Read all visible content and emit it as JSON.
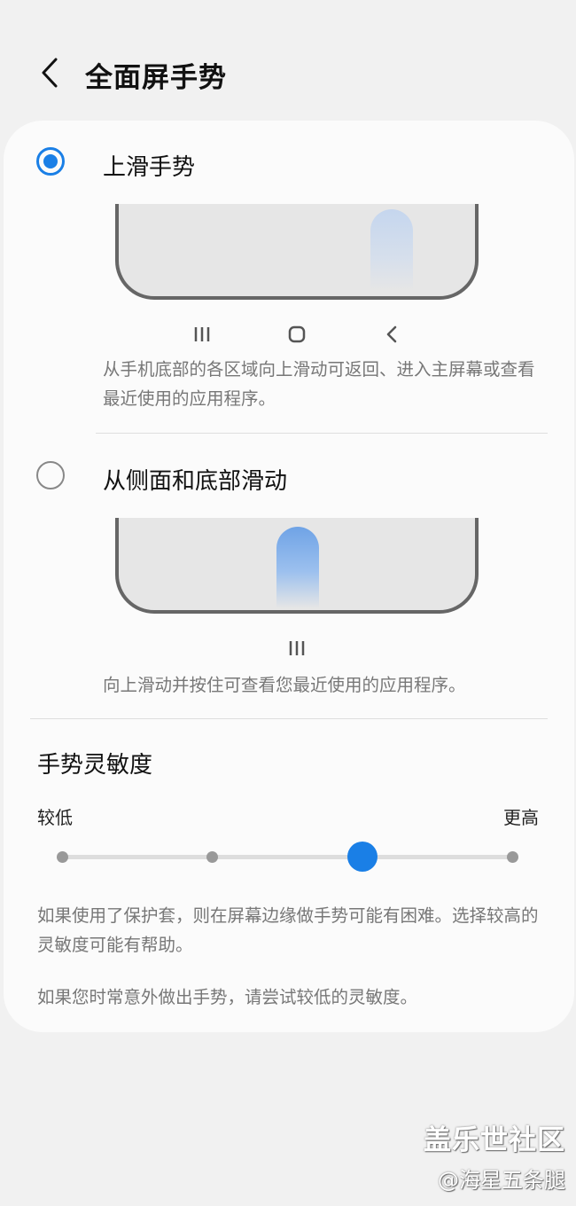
{
  "header": {
    "title": "全面屏手势"
  },
  "options": [
    {
      "label": "上滑手势",
      "selected": true,
      "description": "从手机底部的各区域向上滑动可返回、进入主屏幕或查看最近使用的应用程序。",
      "nav_icons": [
        "recents-icon",
        "home-icon",
        "back-icon"
      ]
    },
    {
      "label": "从侧面和底部滑动",
      "selected": false,
      "description": "向上滑动并按住可查看您最近使用的应用程序。",
      "nav_icons": [
        "recents-icon"
      ]
    }
  ],
  "sensitivity": {
    "title": "手势灵敏度",
    "low_label": "较低",
    "high_label": "更高",
    "steps": 4,
    "value": 3,
    "note1": "如果使用了保护套，则在屏幕边缘做手势可能有困难。选择较高的灵敏度可能有帮助。",
    "note2": "如果您时常意外做出手势，请尝试较低的灵敏度。"
  },
  "colors": {
    "accent": "#1a7fe6",
    "background": "#f1f1f1",
    "card": "#fbfbfb"
  },
  "watermark": {
    "line1": "盖乐世社区",
    "line2": "@海星五条腿"
  }
}
